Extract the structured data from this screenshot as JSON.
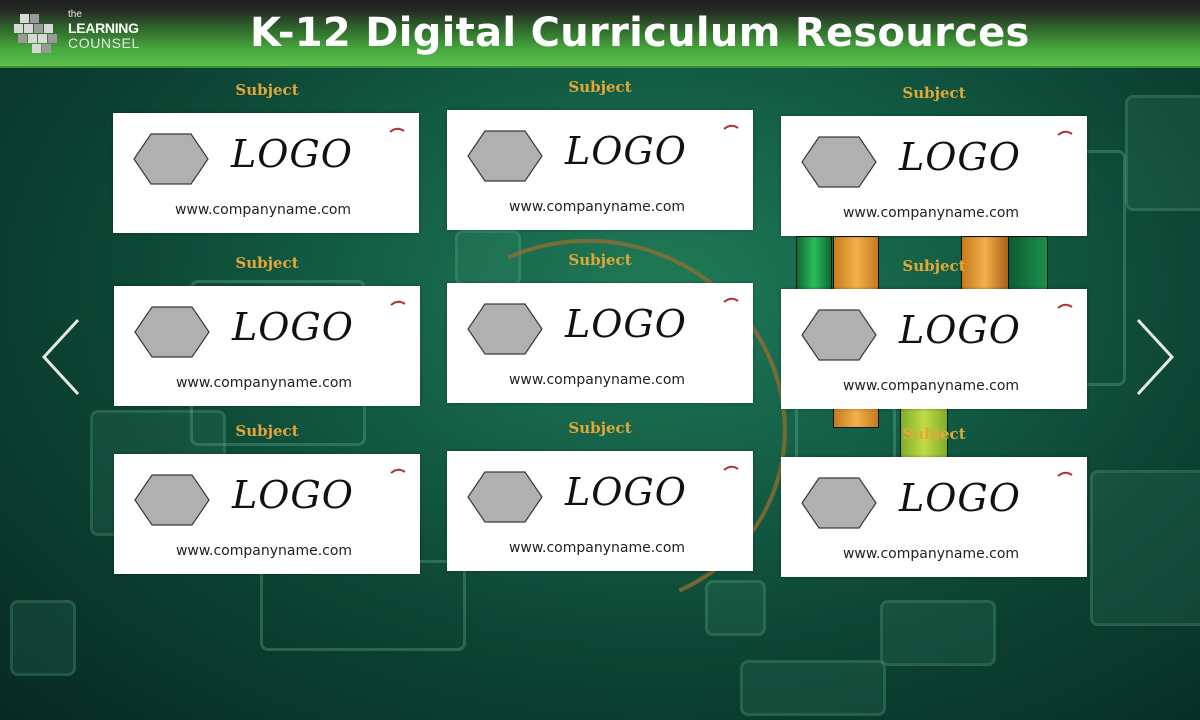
{
  "header": {
    "brand_line1": "the",
    "brand_line2": "LEARNING",
    "brand_line3": "COUNSEL",
    "title": "K-12 Digital Curriculum Resources"
  },
  "icons": {
    "prev": "chevron-left-icon",
    "next": "chevron-right-icon",
    "placeholder": "hexagon-icon"
  },
  "colors": {
    "subject_text": "#e2a737",
    "header_green": "#46a63e",
    "hexagon_fill": "#b0b0b0",
    "accent_mark": "#b03030"
  },
  "cards": [
    {
      "subject": "Subject",
      "logo": "LOGO",
      "url": "www.companyname.com"
    },
    {
      "subject": "Subject",
      "logo": "LOGO",
      "url": "www.companyname.com"
    },
    {
      "subject": "Subject",
      "logo": "LOGO",
      "url": "www.companyname.com"
    },
    {
      "subject": "Subject",
      "logo": "LOGO",
      "url": "www.companyname.com"
    },
    {
      "subject": "Subject",
      "logo": "LOGO",
      "url": "www.companyname.com"
    },
    {
      "subject": "Subject",
      "logo": "LOGO",
      "url": "www.companyname.com"
    },
    {
      "subject": "Subject",
      "logo": "LOGO",
      "url": "www.companyname.com"
    },
    {
      "subject": "Subject",
      "logo": "LOGO",
      "url": "www.companyname.com"
    },
    {
      "subject": "Subject",
      "logo": "LOGO",
      "url": "www.companyname.com"
    }
  ]
}
